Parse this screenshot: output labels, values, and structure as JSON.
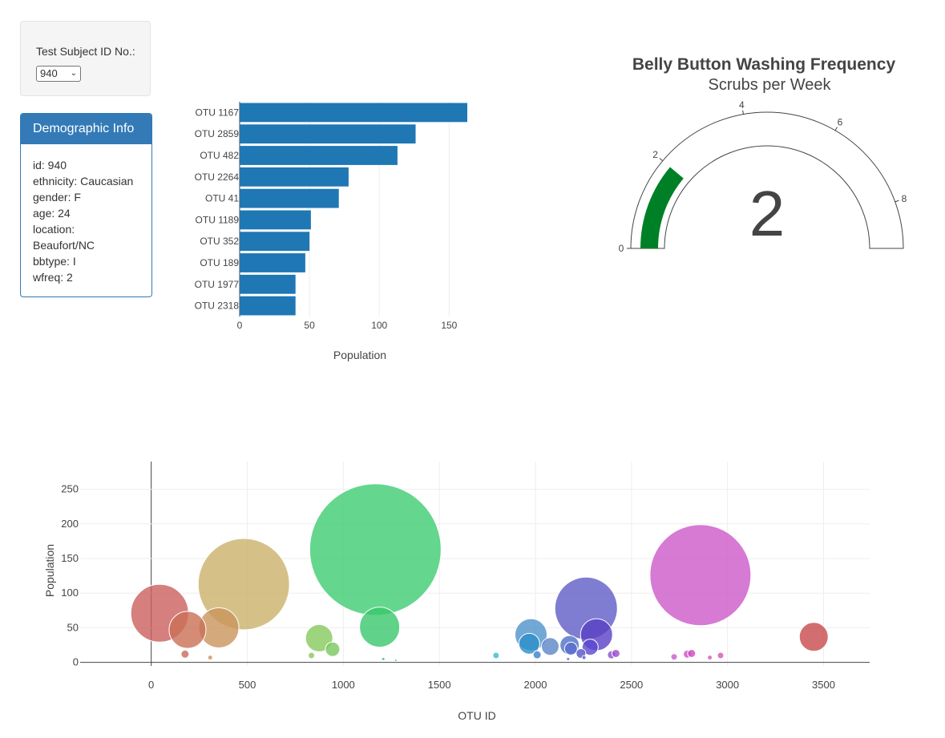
{
  "selector": {
    "label": "Test Subject ID No.:",
    "value": "940"
  },
  "demographic": {
    "heading": "Demographic Info",
    "lines": [
      "id: 940",
      "ethnicity: Caucasian",
      "gender: F",
      "age: 24",
      "location:",
      "Beaufort/NC",
      "bbtype: I",
      "wfreq: 2"
    ]
  },
  "chart_data": [
    {
      "type": "bar",
      "orientation": "horizontal",
      "categories": [
        "OTU 1167",
        "OTU 2859",
        "OTU 482",
        "OTU 2264",
        "OTU 41",
        "OTU 1189",
        "OTU 352",
        "OTU 189",
        "OTU 1977",
        "OTU 2318"
      ],
      "values": [
        163,
        126,
        113,
        78,
        71,
        51,
        50,
        47,
        40,
        40
      ],
      "xlabel": "Population",
      "xlim": [
        0,
        163
      ],
      "xticks": [
        0,
        50,
        100,
        150
      ],
      "grid": true,
      "color": "#1f77b4"
    },
    {
      "type": "gauge",
      "title": "Belly Button Washing Frequency",
      "subtitle": "Scrubs per Week",
      "value": 2,
      "range": [
        0,
        9
      ],
      "ticks": [
        0,
        2,
        4,
        6,
        8
      ],
      "bar_color": "#008026"
    },
    {
      "type": "scatter",
      "style": "bubble",
      "xlabel": "OTU ID",
      "ylabel": "Population",
      "xlim": [
        -370,
        3740
      ],
      "ylim": [
        -5,
        290
      ],
      "xticks": [
        0,
        500,
        1000,
        1500,
        2000,
        2500,
        3000,
        3500
      ],
      "yticks": [
        0,
        50,
        100,
        150,
        200,
        250
      ],
      "grid": true,
      "points": [
        {
          "x": 44,
          "y": 71,
          "r": 36,
          "color": "#ca5f5f"
        },
        {
          "x": 189,
          "y": 47,
          "r": 23,
          "color": "#c96f55"
        },
        {
          "x": 352,
          "y": 50,
          "r": 25,
          "color": "#c9955b"
        },
        {
          "x": 482,
          "y": 113,
          "r": 57,
          "color": "#cbb16a"
        },
        {
          "x": 874,
          "y": 35,
          "r": 17,
          "color": "#86c95e"
        },
        {
          "x": 944,
          "y": 19,
          "r": 9,
          "color": "#78c85e"
        },
        {
          "x": 1167,
          "y": 163,
          "r": 82,
          "color": "#3fcc72"
        },
        {
          "x": 1189,
          "y": 51,
          "r": 25,
          "color": "#38c76c"
        },
        {
          "x": 1977,
          "y": 40,
          "r": 20,
          "color": "#4f92cc"
        },
        {
          "x": 1968,
          "y": 27,
          "r": 13,
          "color": "#2c8ec9"
        },
        {
          "x": 2077,
          "y": 23,
          "r": 11,
          "color": "#5b86c8"
        },
        {
          "x": 2178,
          "y": 25,
          "r": 12,
          "color": "#4e70c5"
        },
        {
          "x": 2264,
          "y": 78,
          "r": 39,
          "color": "#5f5cc6"
        },
        {
          "x": 2318,
          "y": 40,
          "r": 20,
          "color": "#5a40c6"
        },
        {
          "x": 2285,
          "y": 22,
          "r": 10,
          "color": "#5a49d0"
        },
        {
          "x": 2859,
          "y": 126,
          "r": 63,
          "color": "#cc59c9"
        },
        {
          "x": 3449,
          "y": 37,
          "r": 18,
          "color": "#c84a4c"
        },
        {
          "x": 176,
          "y": 12,
          "r": 5,
          "color": "#c86a5a"
        },
        {
          "x": 307,
          "y": 7,
          "r": 3,
          "color": "#c9935c"
        },
        {
          "x": 834,
          "y": 10,
          "r": 4,
          "color": "#8ac763"
        },
        {
          "x": 1795,
          "y": 10,
          "r": 4,
          "color": "#37bcc9"
        },
        {
          "x": 2009,
          "y": 11,
          "r": 5,
          "color": "#3a7fc9"
        },
        {
          "x": 2185,
          "y": 20,
          "r": 8,
          "color": "#5c6bd0"
        },
        {
          "x": 2237,
          "y": 13,
          "r": 6,
          "color": "#5352c8"
        },
        {
          "x": 2396,
          "y": 11,
          "r": 5,
          "color": "#8a4fd0"
        },
        {
          "x": 2419,
          "y": 13,
          "r": 5,
          "color": "#9a48c8"
        },
        {
          "x": 2722,
          "y": 8,
          "r": 4,
          "color": "#c55cc8"
        },
        {
          "x": 2791,
          "y": 12,
          "r": 5,
          "color": "#d14bc6"
        },
        {
          "x": 2813,
          "y": 13,
          "r": 5,
          "color": "#cf47c2"
        },
        {
          "x": 2908,
          "y": 7,
          "r": 3,
          "color": "#d15bb7"
        },
        {
          "x": 2964,
          "y": 10,
          "r": 4,
          "color": "#d455b0"
        },
        {
          "x": 1208,
          "y": 5,
          "r": 2,
          "color": "#3cbf68"
        },
        {
          "x": 1273,
          "y": 3,
          "r": 1.5,
          "color": "#35c07c"
        },
        {
          "x": 2170,
          "y": 5,
          "r": 2,
          "color": "#4f6ac8"
        },
        {
          "x": 2253,
          "y": 7,
          "r": 2.5,
          "color": "#5a5ad0"
        }
      ]
    }
  ]
}
